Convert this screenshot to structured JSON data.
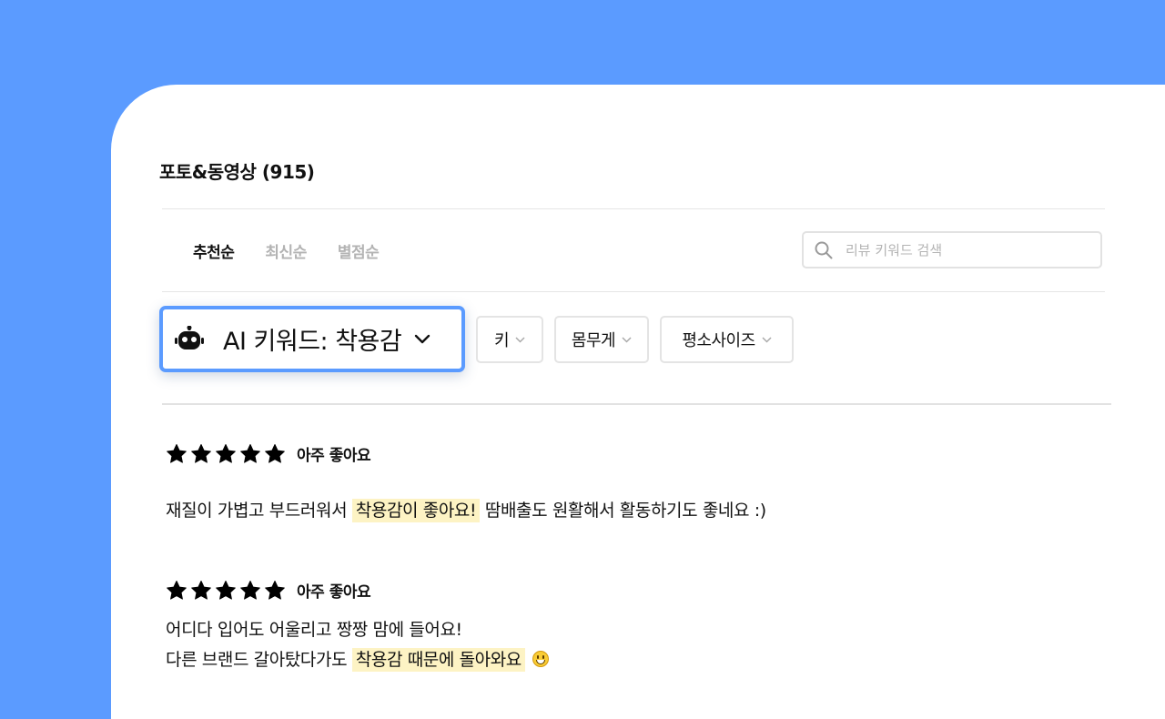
{
  "header": {
    "title": "포토&동영상 (915)"
  },
  "sort_tabs": [
    {
      "label": "추천순",
      "active": true
    },
    {
      "label": "최신순",
      "active": false
    },
    {
      "label": "별점순",
      "active": false
    }
  ],
  "search": {
    "placeholder": "리뷰 키워드 검색",
    "value": "",
    "icon": "search-icon"
  },
  "filters": {
    "ai_keyword": {
      "icon": "robot-icon",
      "label": "AI 키워드: 착용감",
      "accent": "#5b9bff"
    },
    "chips": [
      {
        "label": "키"
      },
      {
        "label": "몸무게"
      },
      {
        "label": "평소사이즈"
      }
    ]
  },
  "reviews": [
    {
      "stars": 5,
      "rating_label": "아주 좋아요",
      "text_before": "재질이 가볍고 부드러워서 ",
      "highlight": "착용감이 좋아요!",
      "text_after": " 땀배출도 원활해서 활동하기도 좋네요 :)"
    },
    {
      "stars": 5,
      "rating_label": "아주 좋아요",
      "line1": "어디다 입어도 어울리고 짱짱 맘에 들어요!",
      "line2_before": "다른 브랜드 갈아탔다가도 ",
      "highlight": "착용감 때문에 돌아와요",
      "emoji": "grinning-face"
    }
  ],
  "colors": {
    "background": "#5b9bff",
    "highlight": "#fdf3c4",
    "star": "#000000"
  }
}
